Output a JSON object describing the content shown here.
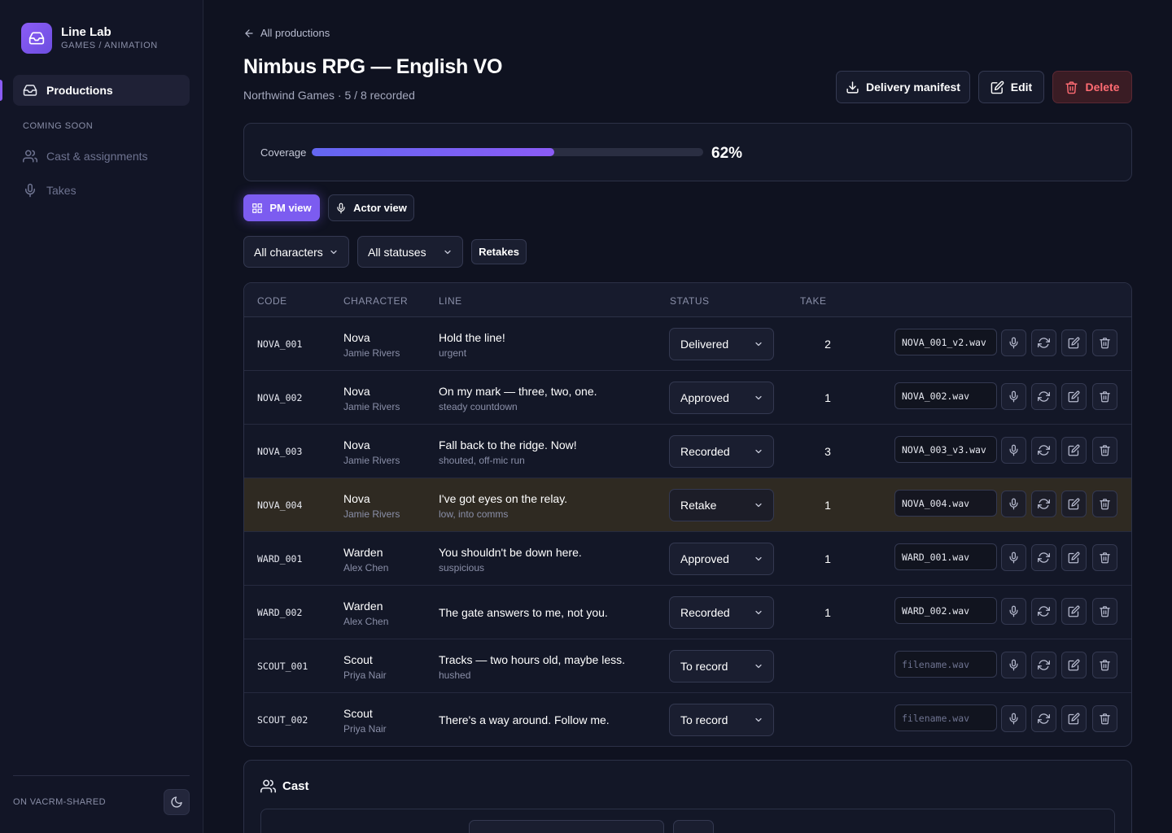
{
  "brand": {
    "name": "Line Lab",
    "subtitle": "GAMES / ANIMATION"
  },
  "sidebar": {
    "active_item": "Productions",
    "section_label": "COMING SOON",
    "items": [
      {
        "label": "Cast & assignments",
        "icon": "users-icon"
      },
      {
        "label": "Takes",
        "icon": "mic-icon"
      }
    ],
    "workspace": "ON VACRM-SHARED",
    "theme_toggle_icon": "moon-icon"
  },
  "header": {
    "back_label": "All productions",
    "title": "Nimbus RPG — English VO",
    "subtitle": "Northwind Games · 5 / 8 recorded",
    "actions": {
      "manifest_label": "Delivery manifest",
      "edit_label": "Edit",
      "delete_label": "Delete"
    }
  },
  "coverage": {
    "label": "Coverage",
    "percent": 62,
    "percent_text": "62%"
  },
  "views": {
    "pm_label": "PM view",
    "actor_label": "Actor view",
    "active": "PM view"
  },
  "filters": {
    "characters": "All characters",
    "statuses": "All statuses",
    "retakes_label": "Retakes"
  },
  "table": {
    "columns": {
      "code": "CODE",
      "character": "CHARACTER",
      "line": "LINE",
      "status": "STATUS",
      "take": "TAKE"
    },
    "file_placeholder": "filename.wav",
    "rows": [
      {
        "code": "NOVA_001",
        "character": "Nova",
        "actor": "Jamie Rivers",
        "line": "Hold the line!",
        "note": "urgent",
        "status": "Delivered",
        "take": "2",
        "file": "NOVA_001_v2.wav"
      },
      {
        "code": "NOVA_002",
        "character": "Nova",
        "actor": "Jamie Rivers",
        "line": "On my mark — three, two, one.",
        "note": "steady countdown",
        "status": "Approved",
        "take": "1",
        "file": "NOVA_002.wav"
      },
      {
        "code": "NOVA_003",
        "character": "Nova",
        "actor": "Jamie Rivers",
        "line": "Fall back to the ridge. Now!",
        "note": "shouted, off-mic run",
        "status": "Recorded",
        "take": "3",
        "file": "NOVA_003_v3.wav"
      },
      {
        "code": "NOVA_004",
        "character": "Nova",
        "actor": "Jamie Rivers",
        "line": "I've got eyes on the relay.",
        "note": "low, into comms",
        "status": "Retake",
        "take": "1",
        "file": "NOVA_004.wav"
      },
      {
        "code": "WARD_001",
        "character": "Warden",
        "actor": "Alex Chen",
        "line": "You shouldn't be down here.",
        "note": "suspicious",
        "status": "Approved",
        "take": "1",
        "file": "WARD_001.wav"
      },
      {
        "code": "WARD_002",
        "character": "Warden",
        "actor": "Alex Chen",
        "line": "The gate answers to me, not you.",
        "note": "",
        "status": "Recorded",
        "take": "1",
        "file": "WARD_002.wav"
      },
      {
        "code": "SCOUT_001",
        "character": "Scout",
        "actor": "Priya Nair",
        "line": "Tracks — two hours old, maybe less.",
        "note": "hushed",
        "status": "To record",
        "take": "",
        "file": ""
      },
      {
        "code": "SCOUT_002",
        "character": "Scout",
        "actor": "Priya Nair",
        "line": "There's a way around. Follow me.",
        "note": "",
        "status": "To record",
        "take": "",
        "file": ""
      }
    ]
  },
  "cast": {
    "title": "Cast"
  },
  "colors": {
    "accent": "#7c5cf0",
    "danger": "#ff6b72",
    "retake_row": "#2f2a22",
    "background": "#0f1220"
  }
}
